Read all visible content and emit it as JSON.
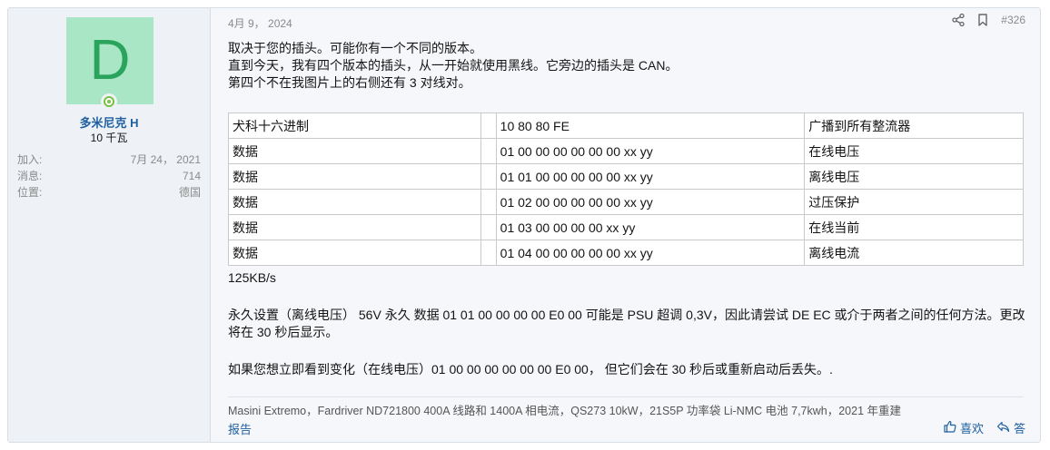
{
  "user": {
    "avatar_letter": "D",
    "name": "多米尼克 H",
    "title": "10 千瓦",
    "stats": [
      {
        "label": "加入:",
        "value": "7月 24， 2021"
      },
      {
        "label": "消息:",
        "value": "714"
      },
      {
        "label": "位置:",
        "value": "德国"
      }
    ]
  },
  "post": {
    "date": "4月 9， 2024",
    "post_number": "#326",
    "lines": [
      "取决于您的插头。可能你有一个不同的版本。",
      "直到今天，我有四个版本的插头，从一开始就使用黑线。它旁边的插头是 CAN。",
      "第四个不在我图片上的右侧还有 3 对线对。"
    ],
    "table": {
      "rows": [
        {
          "c1": "犬科十六进制",
          "c2": "",
          "c3": "10 80 80 FE",
          "c4": "广播到所有整流器"
        },
        {
          "c1": "数据",
          "c2": "",
          "c3": "01 00 00 00 00 00 00 xx yy",
          "c4": "在线电压"
        },
        {
          "c1": "数据",
          "c2": "",
          "c3": "01 01 00 00 00 00 00 xx yy",
          "c4": "离线电压"
        },
        {
          "c1": "数据",
          "c2": "",
          "c3": "01 02 00 00 00 00 00 xx yy",
          "c4": "过压保护"
        },
        {
          "c1": "数据",
          "c2": "",
          "c3": "01 03 00 00 00 00 xx yy",
          "c4": "在线当前"
        },
        {
          "c1": "数据",
          "c2": "",
          "c3": "01 04 00 00 00 00 00 xx yy",
          "c4": "离线电流"
        }
      ]
    },
    "after_table": "125KB/s",
    "para1": "永久设置（离线电压） 56V 永久 数据 01 01 00 00 00 00 E0 00 可能是 PSU 超调 0,3V，因此请尝试 DE EC 或介于两者之间的任何方法。更改将在 30 秒后显示。",
    "para2": "如果您想立即看到变化（在线电压）01 00 00 00 00 00 00 E0 00， 但它们会在 30 秒后或重新启动后丢失。.",
    "signature": "Masini Extremo，Fardriver ND721800 400A 线路和 1400A 相电流，QS273 10kW，21S5P 功率袋 Li-NMC 电池 7,7kwh，2021 年重建",
    "report_label": "报告",
    "like_label": "喜欢",
    "reply_label": "答"
  },
  "icons": {
    "share": "share-icon",
    "bookmark": "bookmark-icon",
    "like": "thumbs-up-icon",
    "reply": "reply-icon",
    "online": "online-status-icon"
  },
  "colors": {
    "avatar_bg": "#a8e6c6",
    "avatar_fg": "#2aa35c",
    "link": "#1f5fa0",
    "online": "#79c244"
  }
}
